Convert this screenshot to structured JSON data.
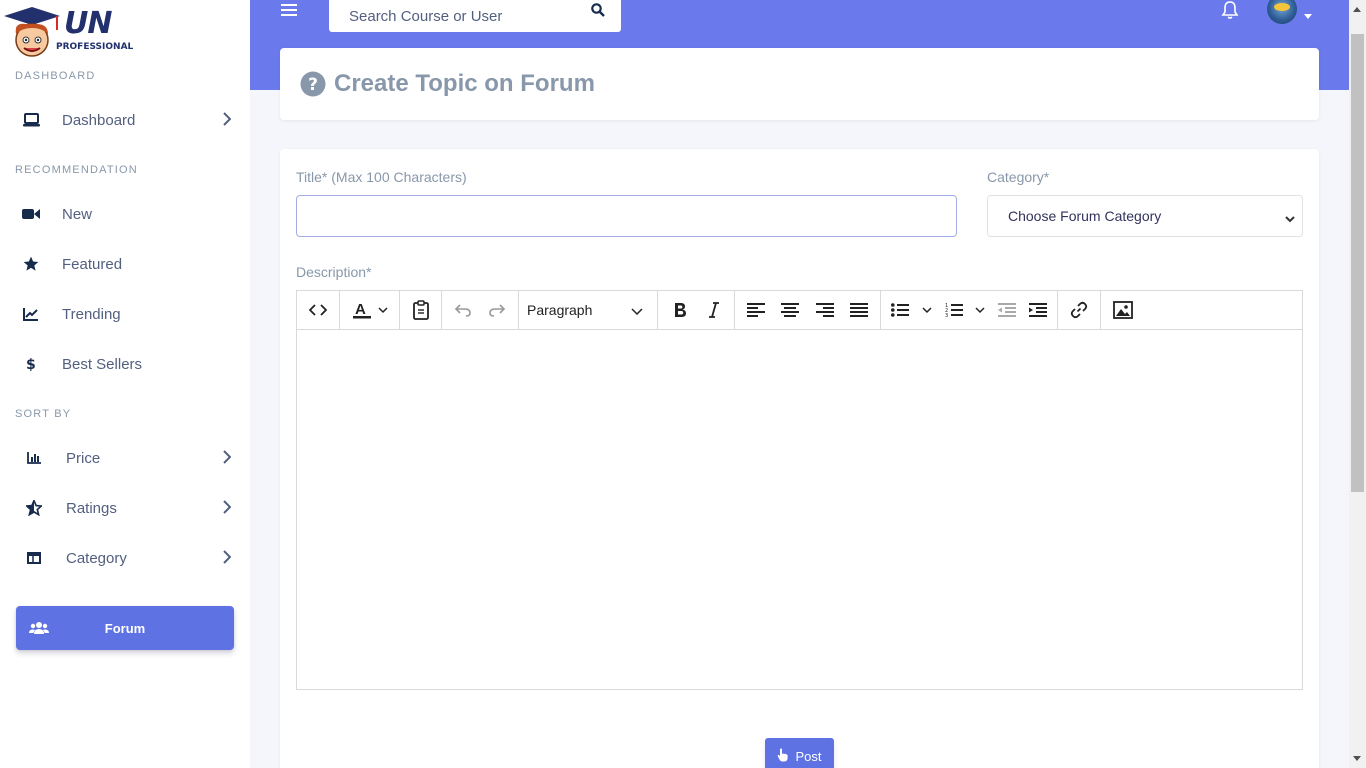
{
  "brand": {
    "logo_main": "UN",
    "logo_sub": "PROFESSIONAL"
  },
  "sidebar": {
    "sections": [
      {
        "label": "DASHBOARD"
      },
      {
        "label": "RECOMMENDATION"
      },
      {
        "label": "SORT BY"
      }
    ],
    "items": [
      {
        "label": "Dashboard",
        "icon": "laptop-icon"
      },
      {
        "label": "New",
        "icon": "video-camera-icon"
      },
      {
        "label": "Featured",
        "icon": "star-icon"
      },
      {
        "label": "Trending",
        "icon": "chart-line-icon"
      },
      {
        "label": "Best Sellers",
        "icon": "dollar-icon"
      },
      {
        "label": "Price",
        "icon": "bar-chart-icon"
      },
      {
        "label": "Ratings",
        "icon": "star-half-icon"
      },
      {
        "label": "Category",
        "icon": "table-icon"
      }
    ],
    "forum": {
      "label": "Forum",
      "icon": "users-icon"
    }
  },
  "header": {
    "search": {
      "placeholder": "Search Course or User",
      "value": ""
    }
  },
  "page": {
    "title": "Create Topic on Forum"
  },
  "form": {
    "title_label": "Title* (Max 100 Characters)",
    "title_value": "",
    "category_label": "Category*",
    "category_selected": "Choose Forum Category",
    "description_label": "Description*",
    "format_block": "Paragraph",
    "post_label": "Post"
  },
  "colors": {
    "accent": "#5e72e4",
    "header_bg": "#6a79eb",
    "muted_text": "#8898aa"
  }
}
